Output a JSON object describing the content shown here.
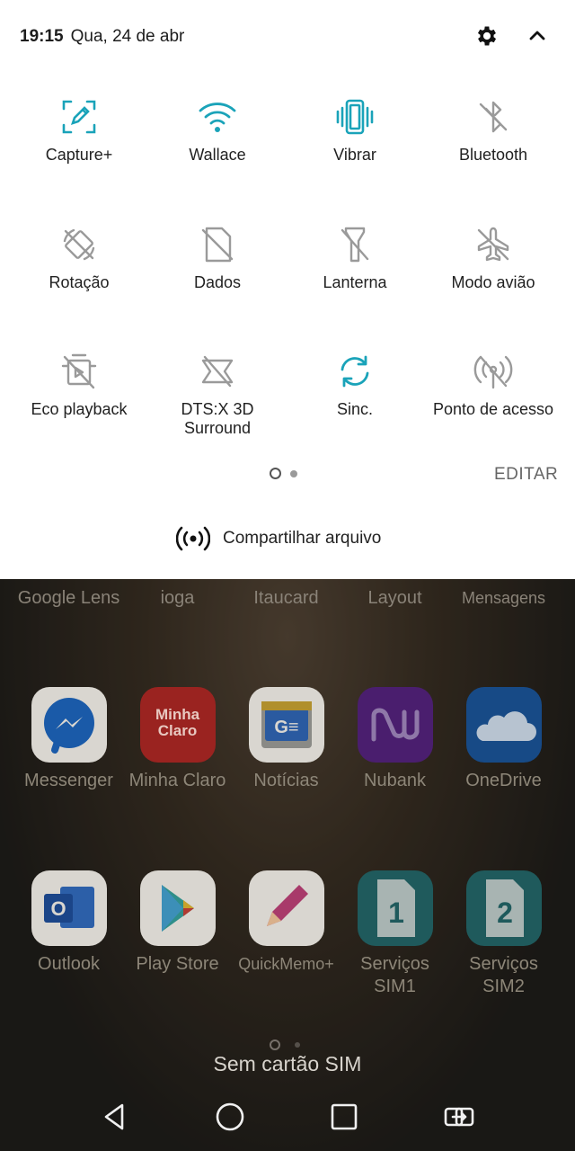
{
  "status_bar": {
    "time": "19:15",
    "date": "Qua, 24 de abr"
  },
  "quick_tiles": [
    {
      "label": "Capture+",
      "icon": "capture-plus-icon",
      "active": true
    },
    {
      "label": "Wallace",
      "icon": "wifi-icon",
      "active": true
    },
    {
      "label": "Vibrar",
      "icon": "vibrate-icon",
      "active": true
    },
    {
      "label": "Bluetooth",
      "icon": "bluetooth-off-icon",
      "active": false
    },
    {
      "label": "Rotação",
      "icon": "rotation-off-icon",
      "active": false
    },
    {
      "label": "Dados",
      "icon": "mobile-data-off-icon",
      "active": false
    },
    {
      "label": "Lanterna",
      "icon": "flashlight-off-icon",
      "active": false
    },
    {
      "label": "Modo avião",
      "icon": "airplane-off-icon",
      "active": false
    },
    {
      "label": "Eco playback",
      "icon": "eco-playback-off-icon",
      "active": false
    },
    {
      "label": "DTS:X 3D Surround",
      "icon": "dts-off-icon",
      "active": false
    },
    {
      "label": "Sinc.",
      "icon": "sync-icon",
      "active": true
    },
    {
      "label": "Ponto de acesso",
      "icon": "hotspot-off-icon",
      "active": false
    }
  ],
  "edit_label": "EDITAR",
  "share_label": "Compartilhar arquivo",
  "home": {
    "folder_labels": [
      "Google Lens",
      "ioga",
      "Itaucard",
      "Layout",
      "Mensagens"
    ],
    "apps_row1": [
      "Messenger",
      "Minha Claro",
      "Notícias",
      "Nubank",
      "OneDrive"
    ],
    "apps_row2": [
      "Outlook",
      "Play Store",
      "QuickMemo+",
      "Serviços SIM1",
      "Serviços SIM2"
    ],
    "sim_status": "Sem cartão SIM",
    "minha_claro_icon_text": "Minha Claro",
    "noticias_icon_text": "G≡",
    "outlook_icon_text": "O",
    "sim1_digit": "1",
    "sim2_digit": "2"
  },
  "colors": {
    "accent_active": "#1aa3b9",
    "inactive_icon": "#9a9a9a",
    "panel_bg": "#ffffff"
  }
}
